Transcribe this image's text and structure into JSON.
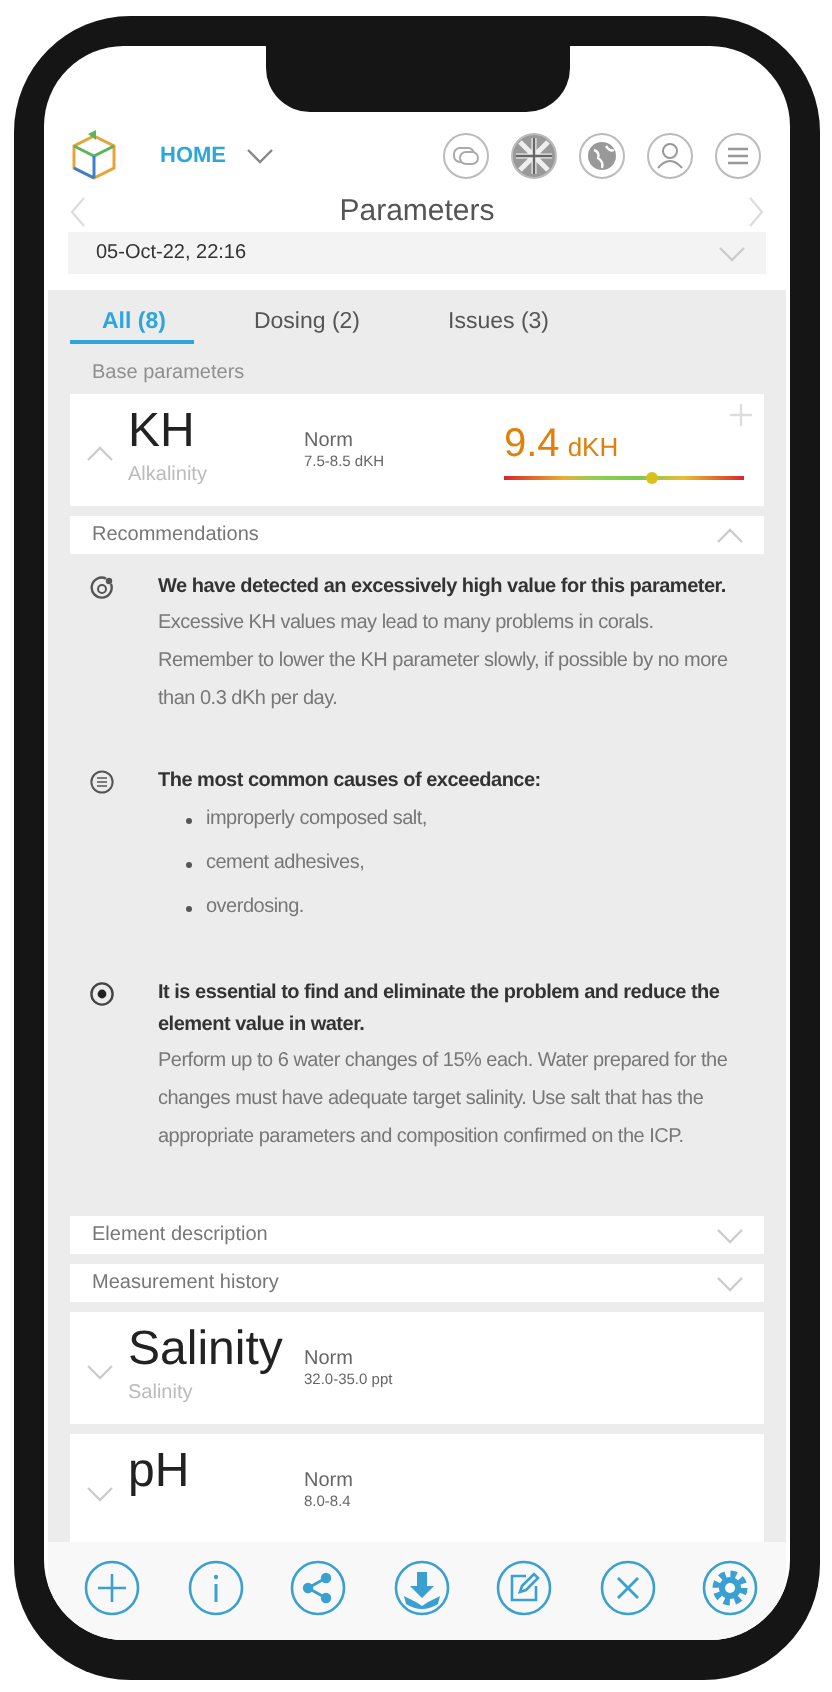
{
  "header": {
    "home_label": "HOME"
  },
  "title": "Parameters",
  "date": "05-Oct-22, 22:16",
  "tabs": [
    {
      "label": "All (8)",
      "selected": true
    },
    {
      "label": "Dosing (2)",
      "selected": false
    },
    {
      "label": "Issues (3)",
      "selected": false
    }
  ],
  "section_label": "Base parameters",
  "parameters": [
    {
      "symbol": "KH",
      "name": "Alkalinity",
      "norm_label": "Norm",
      "norm_range": "7.5-8.5 dKH",
      "value": "9.4",
      "unit": "dKH",
      "level": 0.62,
      "expanded": true,
      "panels": [
        {
          "title": "Recommendations",
          "expanded": true,
          "items": [
            {
              "kind": "target",
              "title": "We have detected an excessively high value for this parameter.",
              "text": "Excessive KH values may lead to many problems in corals. Remember to lower the KH parameter slowly, if possible by no more than 0.3 dKh per day."
            },
            {
              "kind": "list",
              "title": "The most common causes of exceedance:",
              "bullets": [
                "improperly composed salt,",
                "cement adhesives,",
                "overdosing."
              ]
            },
            {
              "kind": "dot",
              "title": "It is essential to find and eliminate the problem and reduce the element value in water.",
              "text": "Perform up to 6 water changes of 15% each. Water prepared for the changes must have adequate target salinity. Use salt that has the appropriate parameters and composition confirmed on the ICP."
            }
          ]
        },
        {
          "title": "Element description",
          "expanded": false
        },
        {
          "title": "Measurement history",
          "expanded": false
        }
      ]
    },
    {
      "symbol": "Salinity",
      "name": "Salinity",
      "norm_label": "Norm",
      "norm_range": "32.0-35.0 ppt",
      "expanded": false
    },
    {
      "symbol": "pH",
      "norm_label": "Norm",
      "norm_range": "8.0-8.4",
      "expanded": false
    }
  ]
}
